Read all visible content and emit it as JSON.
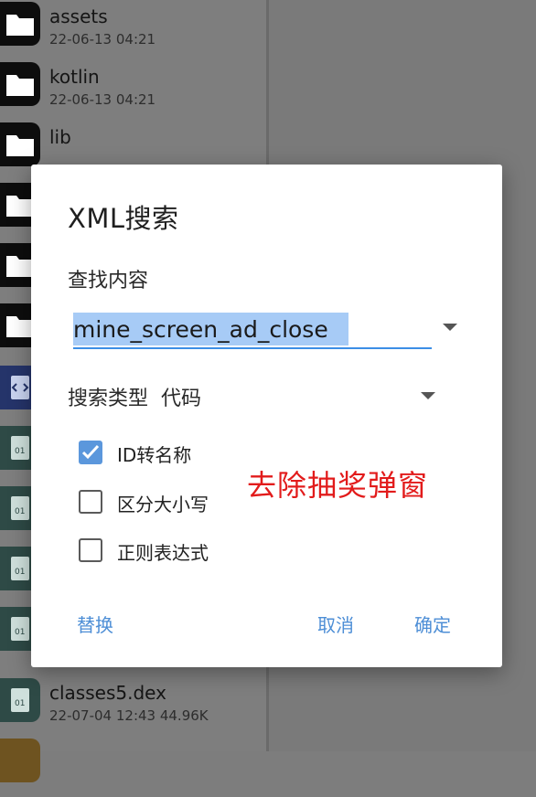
{
  "file_list": [
    {
      "name": "assets",
      "meta": "22-06-13 04:21",
      "icon": "folder-icon",
      "kind": "folder"
    },
    {
      "name": "kotlin",
      "meta": "22-06-13 04:21",
      "icon": "folder-icon",
      "kind": "folder"
    },
    {
      "name": "lib",
      "meta": "",
      "icon": "folder-icon",
      "kind": "folder"
    },
    {
      "name": "",
      "meta": "",
      "icon": "folder-icon",
      "kind": "folder"
    },
    {
      "name": "",
      "meta": "",
      "icon": "folder-icon",
      "kind": "folder"
    },
    {
      "name": "",
      "meta": "",
      "icon": "folder-icon",
      "kind": "folder"
    },
    {
      "name": "",
      "meta": "",
      "icon": "code-file-icon",
      "kind": "code"
    },
    {
      "name": "",
      "meta": "",
      "icon": "dex-file-icon",
      "kind": "dex"
    },
    {
      "name": "",
      "meta": "",
      "icon": "dex-file-icon",
      "kind": "dex"
    },
    {
      "name": "",
      "meta": "",
      "icon": "dex-file-icon",
      "kind": "dex"
    },
    {
      "name": "",
      "meta": "",
      "icon": "dex-file-icon",
      "kind": "dex"
    },
    {
      "name": "classes5.dex",
      "meta": "22-07-04 12:43  44.96K",
      "icon": "dex-file-icon",
      "kind": "dex"
    },
    {
      "name": "",
      "meta": "",
      "icon": "package-file-icon",
      "kind": "pkg"
    }
  ],
  "dialog": {
    "title": "XML搜索",
    "find_label": "查找内容",
    "search": {
      "value": "mine_screen_ad_close",
      "placeholder": ""
    },
    "search_type_label": "搜索类型",
    "search_type_value": "代码",
    "options": [
      {
        "label": "ID转名称",
        "checked": true
      },
      {
        "label": "区分大小写",
        "checked": false
      },
      {
        "label": "正则表达式",
        "checked": false
      }
    ],
    "annotation": "去除抽奖弹窗",
    "buttons": {
      "replace": "替换",
      "cancel": "取消",
      "ok": "确定"
    }
  },
  "colors": {
    "accent": "#4d8ed6",
    "checkbox_checked": "#5b97dc",
    "selection_highlight": "#a7cbf6",
    "annotation": "#e21b1b"
  }
}
